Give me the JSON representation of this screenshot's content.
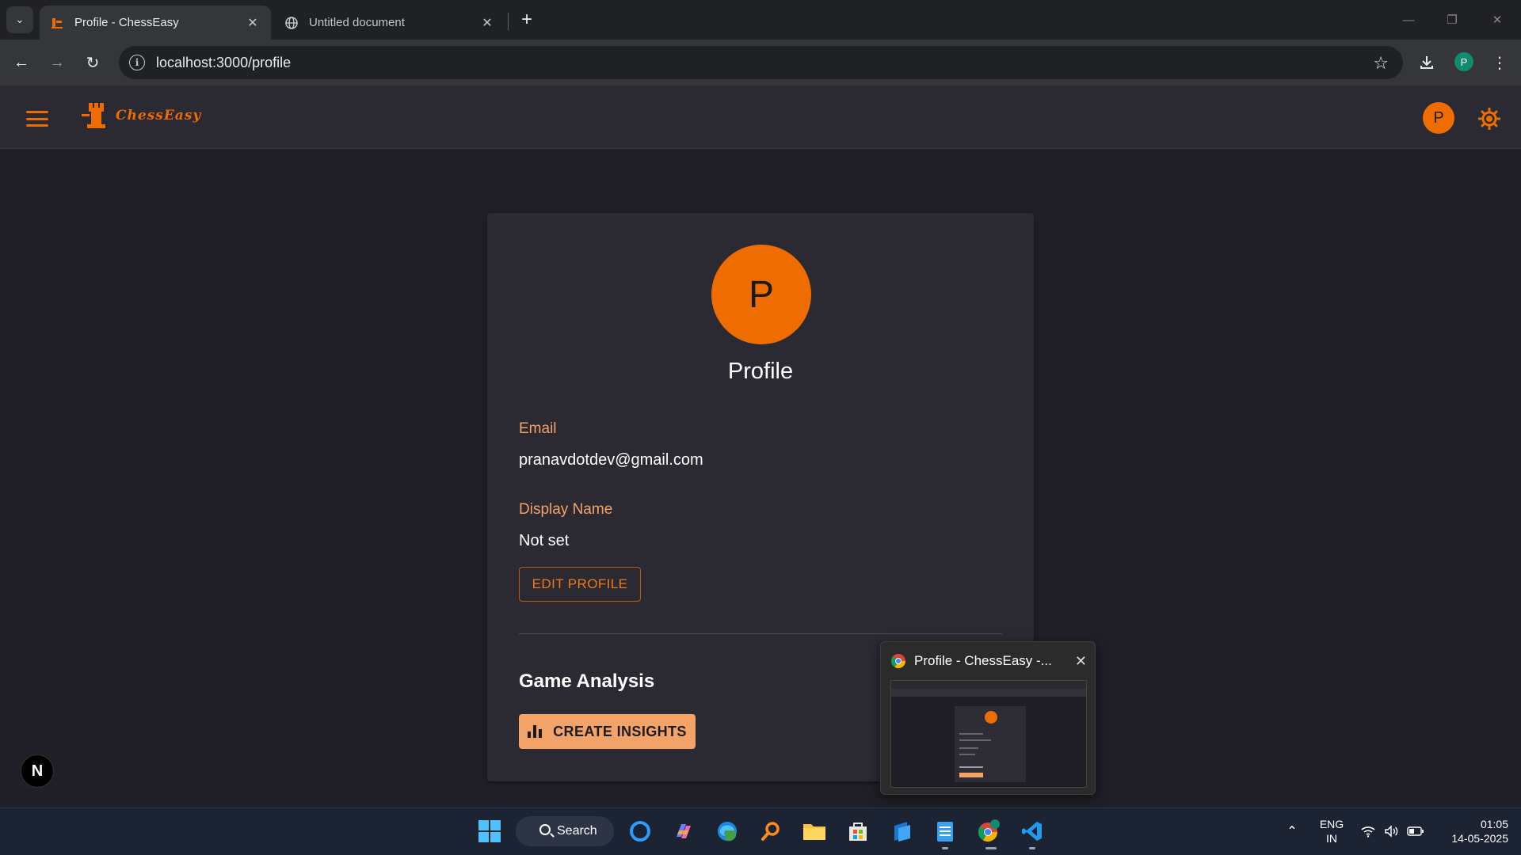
{
  "browser": {
    "tabs": [
      {
        "title": "Profile - ChessEasy",
        "active": true
      },
      {
        "title": "Untitled document",
        "active": false
      }
    ],
    "url": "localhost:3000/profile",
    "profile_initial": "P"
  },
  "app": {
    "logo_text": "ChessEasy",
    "user_initial": "P",
    "accent_color": "#ef6c00"
  },
  "profile": {
    "avatar_initial": "P",
    "title": "Profile",
    "email_label": "Email",
    "email_value": "pranavdotdev@gmail.com",
    "display_name_label": "Display Name",
    "display_name_value": "Not set",
    "edit_button": "EDIT PROFILE",
    "section_title": "Game Analysis",
    "insights_button": "CREATE INSIGHTS"
  },
  "dev_badge": "N",
  "preview": {
    "title": "Profile - ChessEasy -..."
  },
  "taskbar": {
    "search_label": "Search",
    "language": "ENG",
    "region": "IN",
    "time": "01:05",
    "date": "14-05-2025"
  }
}
